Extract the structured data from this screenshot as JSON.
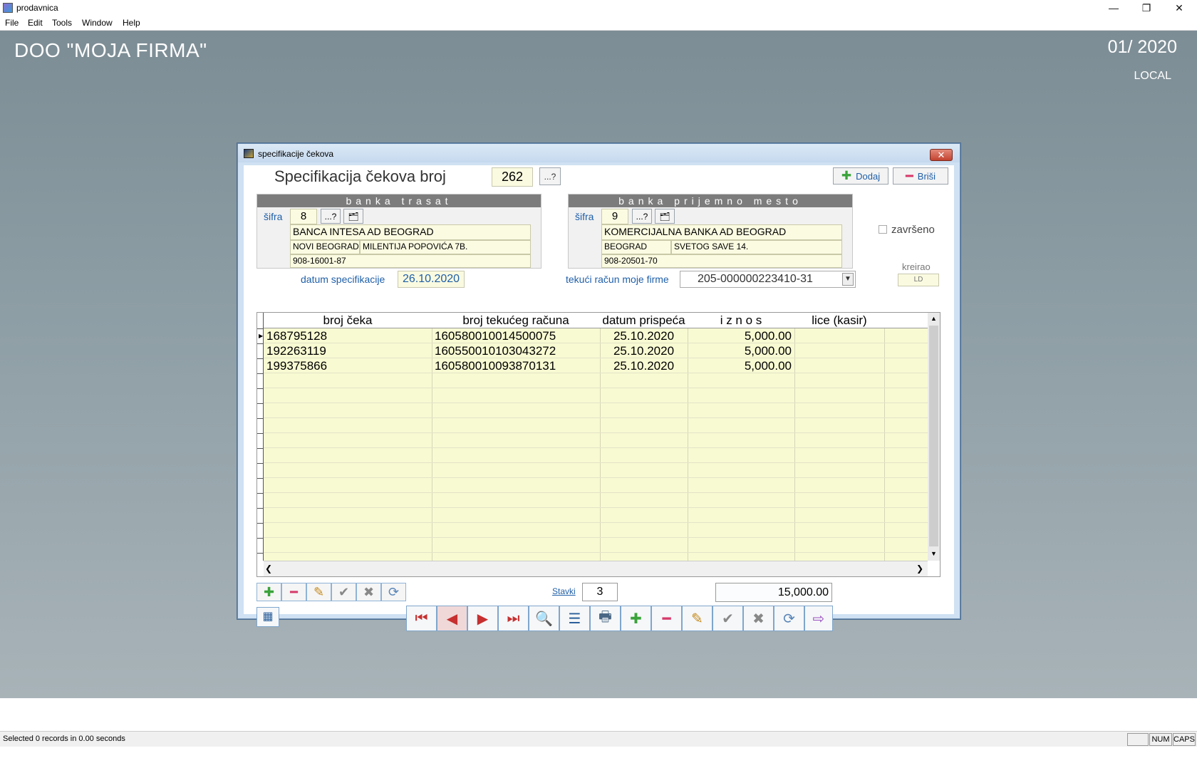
{
  "window": {
    "app_title": "prodavnica",
    "minimize": "—",
    "restore": "❐",
    "close": "✕"
  },
  "menu": {
    "items": [
      "File",
      "Edit",
      "Tools",
      "Window",
      "Help"
    ]
  },
  "desktop": {
    "company": "DOO  \"MOJA FIRMA\"",
    "period": "01/ 2020",
    "mode": "LOCAL"
  },
  "dialog": {
    "title": "specifikacije čekova",
    "heading": "Specifikacija čekova broj",
    "number": "262",
    "lookup_label": "...?",
    "add_label": "Dodaj",
    "delete_label": "Briši",
    "bank_trasat": {
      "title": "banka trasat",
      "sifra_label": "šifra",
      "sifra": "8",
      "name": "BANCA INTESA AD BEOGRAD",
      "city": "NOVI BEOGRAD",
      "street": "MILENTIJA POPOVIĆA 7B.",
      "account": "908-16001-87"
    },
    "bank_prijemno": {
      "title": "banka prijemno mesto",
      "sifra_label": "šifra",
      "sifra": "9",
      "name": "KOMERCIJALNA BANKA AD BEOGRAD",
      "city": "BEOGRAD",
      "street": "SVETOG SAVE 14.",
      "account": "908-20501-70"
    },
    "zavrseno_label": "završeno",
    "kreirao_label": "kreirao",
    "kreirao_value": "LD",
    "datum_label": "datum specifikacije",
    "datum_value": "26.10.2020",
    "tekuci_label": "tekući račun moje firme",
    "tekuci_value": "205-000000223410-31",
    "grid": {
      "columns": [
        "broj čeka",
        "broj tekućeg računa",
        "datum prispeća",
        "i z n o s",
        "lice (kasir)"
      ],
      "rows": [
        {
          "broj": "168795128",
          "racun": "160580010014500075",
          "datum": "25.10.2020",
          "iznos": "5,000.00",
          "lice": ""
        },
        {
          "broj": "192263119",
          "racun": "160550010103043272",
          "datum": "25.10.2020",
          "iznos": "5,000.00",
          "lice": ""
        },
        {
          "broj": "199375866",
          "racun": "160580010093870131",
          "datum": "25.10.2020",
          "iznos": "5,000.00",
          "lice": ""
        }
      ]
    },
    "stavki_label": "Stavki",
    "stavki_value": "3",
    "total": "15,000.00"
  },
  "status": {
    "text": "Selected 0 records in 0.00 seconds",
    "num": "NUM",
    "caps": "CAPS"
  },
  "colors": {
    "accent_blue": "#1f5fa8",
    "grid_yellow": "#f8fad2",
    "desktop": "#8f9fa6"
  }
}
